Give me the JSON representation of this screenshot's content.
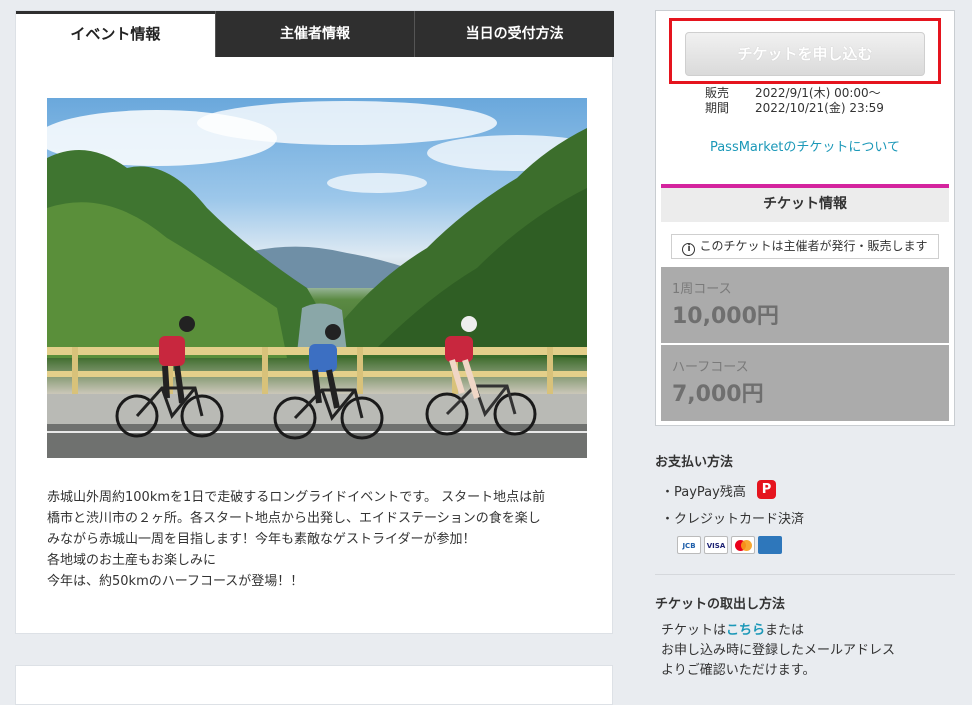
{
  "tabs": [
    {
      "label": "イベント情報",
      "active": true
    },
    {
      "label": "主催者情報",
      "active": false
    },
    {
      "label": "当日の受付方法",
      "active": false
    }
  ],
  "description": {
    "lines": [
      "赤城山外周約100kmを1日で走破するロングライドイベントです。 スタート地点は前",
      "橋市と渋川市の２ヶ所。各スタート地点から出発し、エイドステーションの食を楽し",
      "みながら赤城山一周を目指します！今年も素敵なゲストライダーが参加！",
      "各地域のお土産もお楽しみに",
      "今年は、約50kmのハーフコースが登場！！"
    ]
  },
  "ticket": {
    "apply_button": "チケットを申し込む",
    "sales_label_1": "販売",
    "sales_label_2": "期間",
    "sales_start": "2022/9/1(木) 00:00～",
    "sales_end": "2022/10/21(金) 23:59",
    "passmarket_link": "PassMarketのチケットについて",
    "info_header": "チケット情報",
    "notice": "このチケットは主催者が発行・販売します",
    "courses": [
      {
        "name": "1周コース",
        "price": "10,000円"
      },
      {
        "name": "ハーフコース",
        "price": "7,000円"
      }
    ]
  },
  "payment": {
    "title": "お支払い方法",
    "methods": [
      "・PayPay残高",
      "・クレジットカード決済"
    ],
    "paypay_glyph": "P",
    "card_brands": [
      "JCB",
      "VISA",
      "Mastercard",
      "AMEX"
    ]
  },
  "pickup": {
    "title": "チケットの取出し方法",
    "line1_pre": "チケットは",
    "line1_link": "こちら",
    "line1_post": "または",
    "line2": "お申し込み時に登録したメールアドレス",
    "line3": "よりご確認いただけます。"
  },
  "colors": {
    "highlight_border": "#e5141e",
    "accent_pink": "#d4249e",
    "link": "#1b98b8",
    "tab_dark": "#2f2f2f"
  }
}
